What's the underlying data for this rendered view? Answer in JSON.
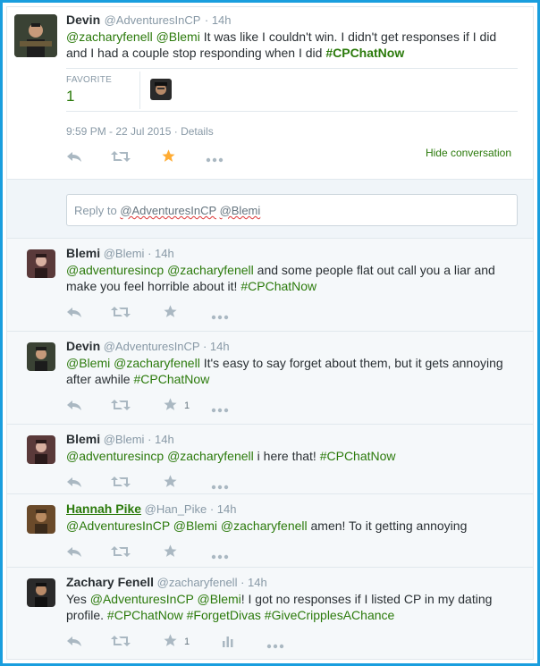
{
  "main_tweet": {
    "name": "Devin",
    "handle": "@AdventuresInCP",
    "time": "· 14h",
    "text_parts": [
      {
        "t": "@zacharyfenell",
        "type": "link"
      },
      {
        "t": " ",
        "type": "text"
      },
      {
        "t": "@Blemi",
        "type": "link"
      },
      {
        "t": " It was like I couldn't win. I didn't get responses if I did and I had a couple stop responding when I did ",
        "type": "text"
      },
      {
        "t": "#CPChatNow",
        "type": "hashtag"
      }
    ],
    "favorite_label": "FAVORITE",
    "favorite_count": "1",
    "timestamp": "9:59 PM - 22 Jul 2015 · Details",
    "hide_conversation": "Hide conversation"
  },
  "reply_box": {
    "prefix": "Reply to ",
    "mention1": "@AdventuresInCP",
    "mention2": "@Blemi"
  },
  "replies": [
    {
      "name": "Blemi",
      "handle": "@Blemi",
      "time": "· 14h",
      "text": "@adventuresincp @zacharyfenell and some people flat out call you a liar and make you feel horrible about it! #CPChatNow",
      "fav_count": ""
    },
    {
      "name": "Devin",
      "handle": "@AdventuresInCP",
      "time": "· 14h",
      "text": "@Blemi @zacharyfenell It's easy to say forget about them, but it gets annoying after awhile #CPChatNow",
      "fav_count": "1"
    },
    {
      "name": "Blemi",
      "handle": "@Blemi",
      "time": "· 14h",
      "text": "@adventuresincp @zacharyfenell i here that! #CPChatNow",
      "fav_count": ""
    },
    {
      "name": "Hannah Pike",
      "handle": "@Han_Pike",
      "time": "· 14h",
      "text": "@AdventuresInCP @Blemi @zacharyfenell amen! To it getting annoying",
      "fav_count": ""
    },
    {
      "name": "Zachary Fenell",
      "handle": "@zacharyfenell",
      "time": "· 14h",
      "text": "Yes @AdventuresInCP @Blemi! I got no responses if I listed CP in my dating profile. #CPChatNow #ForgetDivas #GiveCripplesAChance",
      "fav_count": "1"
    }
  ],
  "colors": {
    "frame": "#1a9ede",
    "link": "#2b7a0b",
    "favorite_star": "#ffac33",
    "muted": "#8899a6",
    "tweet_bg": "#f5f8fa"
  },
  "icons": [
    "reply-icon",
    "retweet-icon",
    "star-icon",
    "more-icon",
    "analytics-icon"
  ]
}
